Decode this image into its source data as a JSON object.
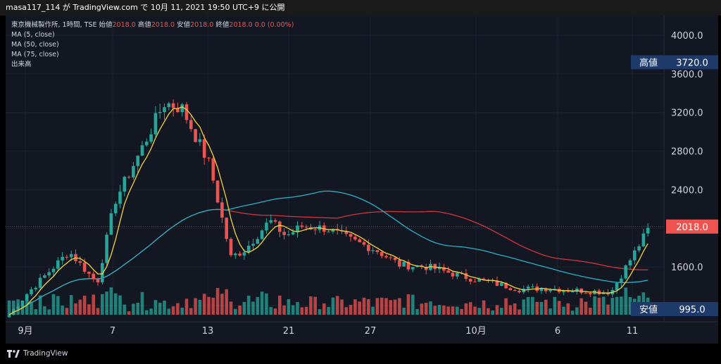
{
  "header": {
    "publish_line": "masa117_114 が TradingView.com で 10月 11, 2021 19:50 UTC+9 に公開"
  },
  "legend": {
    "symbol_line_prefix": "東京機械製作所, 1時間, TSE",
    "ohlc": [
      {
        "label": "始値",
        "value": "2018.0"
      },
      {
        "label": "高値",
        "value": "2018.0"
      },
      {
        "label": "安値",
        "value": "2018.0"
      },
      {
        "label": "終値",
        "value": "2018.0"
      }
    ],
    "change": "0.0 (0.00%)",
    "indicators": [
      "MA (5, close)",
      "MA (50, close)",
      "MA (75, close)",
      "出来高"
    ]
  },
  "footer": {
    "brand": "TradingView"
  },
  "colors": {
    "background": "#131722",
    "up": "#26a69a",
    "down": "#ef5350",
    "ma5": "#f5d438",
    "ma50": "#26b3c9",
    "ma75": "#d3363d",
    "label_bg": "#1e3a6b",
    "last_price_bg": "#ef5350"
  },
  "chart_data": {
    "type": "candlestick",
    "title": "",
    "y_axis_ticks": [
      "4000.0",
      "3600.0",
      "3200.0",
      "2800.0",
      "2400.0",
      "2000.0",
      "1600.0",
      "1200.0"
    ],
    "x_axis_ticks": [
      "9月",
      "7",
      "13",
      "21",
      "27",
      "10月",
      "6",
      "11"
    ],
    "ylim": [
      950,
      4100
    ],
    "grid": true,
    "high_label": {
      "label": "高値",
      "value": "3720.0"
    },
    "low_label": {
      "label": "安値",
      "value": "995.0"
    },
    "last_price": "2018.0",
    "approx_price_path": [
      {
        "d": "Sep 1",
        "close": 1060
      },
      {
        "d": "Sep 2",
        "close": 1320
      },
      {
        "d": "Sep 3",
        "close": 1760
      },
      {
        "d": "Sep 6",
        "close": 1430
      },
      {
        "d": "Sep 7",
        "close": 2280
      },
      {
        "d": "Sep 8",
        "close": 2850
      },
      {
        "d": "Sep 9",
        "close": 3300
      },
      {
        "d": "Sep 10",
        "close": 3250
      },
      {
        "d": "Sep 13",
        "close": 2650
      },
      {
        "d": "Sep 14",
        "close": 1700
      },
      {
        "d": "Sep 15",
        "close": 1780
      },
      {
        "d": "Sep 16",
        "close": 2080
      },
      {
        "d": "Sep 17",
        "close": 1920
      },
      {
        "d": "Sep 21",
        "close": 2020
      },
      {
        "d": "Sep 22",
        "close": 2000
      },
      {
        "d": "Sep 24",
        "close": 1880
      },
      {
        "d": "Sep 27",
        "close": 1780
      },
      {
        "d": "Sep 28",
        "close": 1620
      },
      {
        "d": "Sep 29",
        "close": 1600
      },
      {
        "d": "Sep 30",
        "close": 1540
      },
      {
        "d": "Oct 1",
        "close": 1500
      },
      {
        "d": "Oct 4",
        "close": 1420
      },
      {
        "d": "Oct 5",
        "close": 1370
      },
      {
        "d": "Oct 6",
        "close": 1380
      },
      {
        "d": "Oct 7",
        "close": 1360
      },
      {
        "d": "Oct 8",
        "close": 1340
      },
      {
        "d": "Oct 11",
        "close": 2018
      }
    ]
  }
}
